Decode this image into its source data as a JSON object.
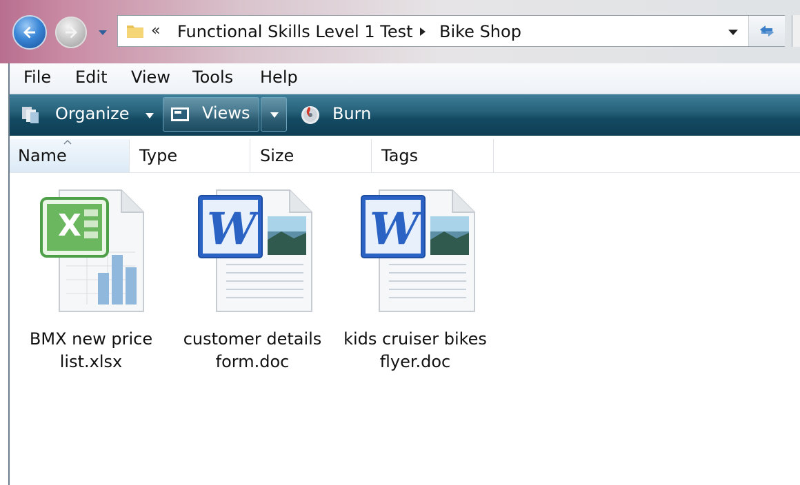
{
  "address_bar": {
    "overflow_chevron": "«",
    "path": [
      "Functional Skills Level 1 Test",
      "Bike Shop"
    ]
  },
  "menu": [
    "File",
    "Edit",
    "View",
    "Tools",
    "Help"
  ],
  "command_bar": {
    "organize": "Organize",
    "views": "Views",
    "burn": "Burn"
  },
  "columns": [
    "Name",
    "Type",
    "Size",
    "Tags"
  ],
  "sorted_column": "Name",
  "files": [
    {
      "name_line1": "BMX new price",
      "name_line2": "list.xlsx",
      "icon": "excel-file-icon"
    },
    {
      "name_line1": "customer details",
      "name_line2": "form.doc",
      "icon": "word-file-icon"
    },
    {
      "name_line1": "kids cruiser bikes",
      "name_line2": "flyer.doc",
      "icon": "word-file-icon"
    }
  ],
  "colors": {
    "command_bar": "#1d5670",
    "back_button": "#3a86d6",
    "excel_green": "#2e8b3a",
    "word_blue": "#2a63c4"
  }
}
